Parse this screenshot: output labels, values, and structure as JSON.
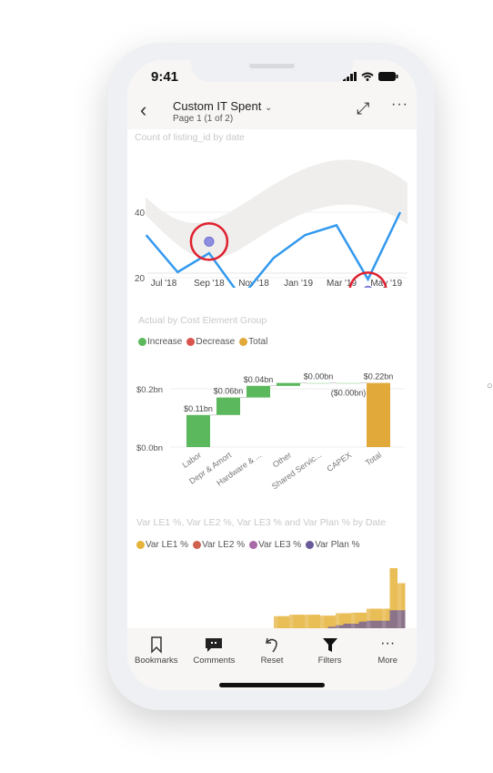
{
  "status_bar": {
    "time": "9:41"
  },
  "header": {
    "title": "Custom IT Spent",
    "subtitle": "Page 1 (1 of 2)",
    "back_icon": "chevron-left-icon",
    "dropdown_icon": "chevron-down-icon",
    "expand_icon": "expand-icon",
    "more_icon": "ellipsis-icon"
  },
  "colors": {
    "line": "#3399ee",
    "band": "#efeeed",
    "anomaly": "#8e8fe0",
    "highlight": "#e0202e",
    "increase": "#5cb85c",
    "decrease": "#d9534f",
    "total": "#e0a93a",
    "le1": "#e5b33a",
    "le2": "#d0614f",
    "le3": "#a86aa8",
    "plan": "#6b5a9a"
  },
  "chart_data": [
    {
      "type": "line",
      "title": "Count of listing_id by date",
      "ylim": [
        0,
        45
      ],
      "yticks": [
        20,
        40
      ],
      "ytick_labels": [
        "20",
        "40"
      ],
      "xtick_labels": [
        "Jul '18",
        "Sep '18",
        "Nov '18",
        "Jan '19",
        "Mar '19",
        "May '19"
      ],
      "xtick_dates": [
        "2018-07-01",
        "2018-09-01",
        "2018-11-01",
        "2019-01-01",
        "2019-03-01",
        "2019-05-01"
      ],
      "x": [
        "2018-06-07",
        "2018-07-20",
        "2018-09-01",
        "2018-10-15",
        "2018-11-28",
        "2019-01-10",
        "2019-02-22",
        "2019-04-06",
        "2019-05-20"
      ],
      "values": [
        33,
        21.7,
        27.5,
        14,
        26,
        33,
        36,
        19.5,
        40
      ],
      "anomalies": [
        {
          "x": "2018-09-01",
          "value": 31
        },
        {
          "x": "2019-04-06",
          "value": 16
        }
      ],
      "grid": true
    },
    {
      "type": "bar",
      "subtype": "waterfall",
      "title": "Actual by Cost Element Group",
      "legend": [
        "Increase",
        "Decrease",
        "Total"
      ],
      "legend_placement": "top-left",
      "categories": [
        "Labor",
        "Depr & Amort",
        "Hardware & ...",
        "Other",
        "Shared Servic...",
        "CAPEX",
        "Total"
      ],
      "values": [
        0.11,
        0.06,
        0.04,
        0.01,
        0.0,
        -0.0,
        0.22
      ],
      "kinds": [
        "increase",
        "increase",
        "increase",
        "increase",
        "increase",
        "decrease",
        "total"
      ],
      "data_labels": [
        "$0.11bn",
        "$0.06bn",
        "$0.04bn",
        "",
        "$0.00bn",
        "($0.00bn)",
        "$0.22bn"
      ],
      "ytick_labels": [
        "$0.0bn",
        "$0.2bn"
      ],
      "yticks": [
        0,
        0.2
      ],
      "ylim": [
        0,
        0.25
      ]
    },
    {
      "type": "area",
      "title": "Var LE1 %, Var LE2 %, Var LE3 % and Var Plan % by Date",
      "legend": [
        "Var LE1 %",
        "Var LE2 %",
        "Var LE3 %",
        "Var Plan %"
      ],
      "legend_placement": "top-left",
      "series": [
        {
          "name": "Var LE1 %",
          "values": [
            0,
            0,
            0,
            0,
            0,
            0,
            4,
            4,
            4.5,
            4.5,
            4.5,
            4.5,
            4.2,
            4.2,
            5,
            5,
            5.2,
            5.2,
            6.5,
            6.5,
            6.5,
            20,
            15
          ]
        },
        {
          "name": "Var Plan %",
          "values": [
            0,
            0,
            0,
            0,
            0,
            0,
            0,
            0,
            0,
            0,
            0,
            0,
            0,
            0.5,
            1,
            1.5,
            1.5,
            2.2,
            2.5,
            2.5,
            2.5,
            6,
            6
          ]
        }
      ]
    }
  ],
  "toolbar": [
    {
      "label": "Bookmarks",
      "icon": "bookmark-icon"
    },
    {
      "label": "Comments",
      "icon": "comment-icon"
    },
    {
      "label": "Reset",
      "icon": "undo-icon"
    },
    {
      "label": "Filters",
      "icon": "filter-icon"
    },
    {
      "label": "More",
      "icon": "ellipsis-icon"
    }
  ]
}
